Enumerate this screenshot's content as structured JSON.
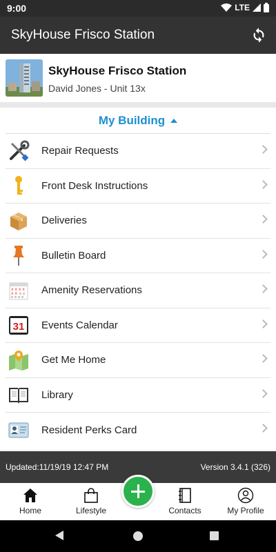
{
  "status_bar": {
    "time": "9:00",
    "network": "LTE"
  },
  "app_bar": {
    "title": "SkyHouse Frisco Station",
    "refresh_icon": "refresh-icon"
  },
  "building": {
    "name": "SkyHouse Frisco Station",
    "resident": "David Jones - Unit 13x"
  },
  "section": {
    "title": "My Building",
    "accent": "#1e8fd0"
  },
  "menu": [
    {
      "label": "Repair Requests",
      "icon": "tools-icon"
    },
    {
      "label": "Front Desk Instructions",
      "icon": "key-icon"
    },
    {
      "label": "Deliveries",
      "icon": "package-icon"
    },
    {
      "label": "Bulletin Board",
      "icon": "pushpin-icon"
    },
    {
      "label": "Amenity Reservations",
      "icon": "calendar-grid-icon"
    },
    {
      "label": "Events Calendar",
      "icon": "calendar-31-icon"
    },
    {
      "label": "Get Me Home",
      "icon": "map-icon"
    },
    {
      "label": "Library",
      "icon": "book-icon"
    },
    {
      "label": "Resident Perks Card",
      "icon": "id-card-icon"
    }
  ],
  "calendar_day": "31",
  "info_bar": {
    "updated": "Updated:11/19/19 12:47 PM",
    "version": "Version 3.4.1 (326)"
  },
  "bottom_nav": [
    {
      "label": "Home",
      "icon": "home-icon"
    },
    {
      "label": "Lifestyle",
      "icon": "shopping-bag-icon"
    },
    {
      "label": "Contacts",
      "icon": "contacts-book-icon"
    },
    {
      "label": "My Profile",
      "icon": "profile-icon"
    }
  ],
  "fab_color": "#2bb24c"
}
